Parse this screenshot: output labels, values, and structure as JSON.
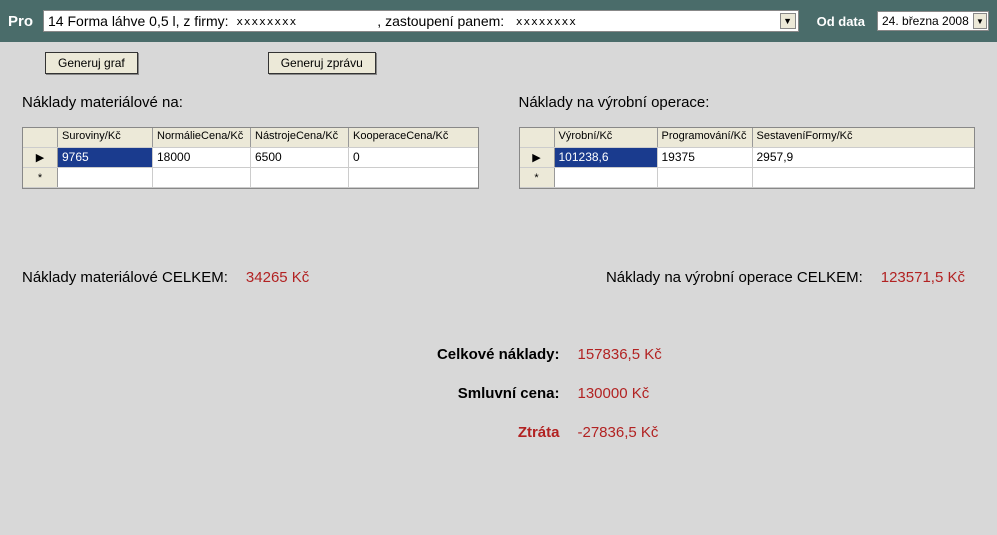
{
  "topbar": {
    "pro_label": "Pro",
    "main_combo_prefix": "14 Forma láhve 0,5 l, z firmy:",
    "main_combo_mask1": "xxxxxxxx",
    "main_combo_mid": ", zastoupení panem:",
    "main_combo_mask2": "xxxxxxxx",
    "od_data_label": "Od data",
    "date_value": "24. března  2008"
  },
  "buttons": {
    "generate_graph": "Generuj graf",
    "generate_report": "Generuj zprávu"
  },
  "material": {
    "title": "Náklady materiálové na:",
    "headers": [
      "Suroviny/Kč",
      "NormálieCena/Kč",
      "NástrojeCena/Kč",
      "KooperaceCena/Kč"
    ],
    "rows": [
      {
        "cells": [
          "9765",
          "18000",
          "6500",
          "0"
        ]
      }
    ],
    "total_label": "Náklady materiálové CELKEM:",
    "total_value": "34265 Kč"
  },
  "operations": {
    "title": "Náklady na výrobní operace:",
    "headers": [
      "Výrobní/Kč",
      "Programování/Kč",
      "SestaveníFormy/Kč"
    ],
    "rows": [
      {
        "cells": [
          "101238,6",
          "19375",
          "2957,9"
        ]
      }
    ],
    "total_label": "Náklady na výrobní operace CELKEM:",
    "total_value": "123571,5 Kč"
  },
  "summary": {
    "total_cost_label": "Celkové náklady:",
    "total_cost_value": "157836,5 Kč",
    "contract_price_label": "Smluvní cena:",
    "contract_price_value": "130000 Kč",
    "loss_label": "Ztráta",
    "loss_value": "-27836,5 Kč"
  },
  "icons": {
    "row_pointer": "▶",
    "row_new": "*",
    "dropdown_arrow": "▼"
  }
}
